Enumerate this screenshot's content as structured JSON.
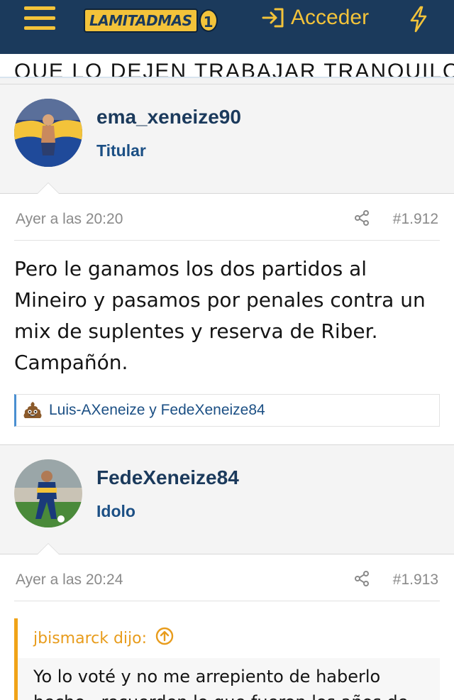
{
  "header": {
    "logo_text": "LAMITADMAS",
    "logo_number": "1",
    "login_label": "Acceder",
    "brand_colors": {
      "navy": "#1b3a5c",
      "gold": "#f3c33a"
    }
  },
  "prev_post": {
    "tail_text": "QUE LO DEJEN TRABAJAR TRANQUILO."
  },
  "posts": [
    {
      "username": "ema_xeneize90",
      "user_title": "Titular",
      "date": "Ayer a las 20:20",
      "post_number": "#1.912",
      "body": "Pero le ganamos los dos partidos al Mineiro y pasamos por penales contra un mix de suplentes y reserva de Riber. Campañón.",
      "reactions": "Luis-AXeneize y FedeXeneize84"
    },
    {
      "username": "FedeXeneize84",
      "user_title": "Idolo",
      "date": "Ayer a las 20:24",
      "post_number": "#1.913",
      "quote_author": "jbismarck dijo:",
      "quote_text": "Yo lo voté y no me arrepiento de haberlo hecho...recuerden lo que fueron los años de"
    }
  ]
}
